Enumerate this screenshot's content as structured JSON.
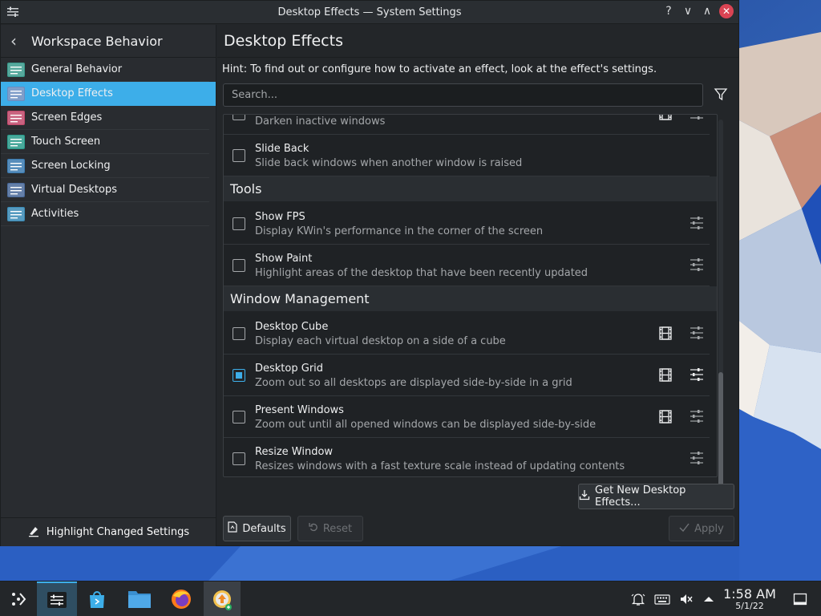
{
  "window": {
    "title": "Desktop Effects — System Settings",
    "help_glyph": "?",
    "minimize_glyph": "∨",
    "maximize_glyph": "∧",
    "close_glyph": "✕"
  },
  "sidebar": {
    "header": "Workspace Behavior",
    "back_glyph": "‹",
    "items": [
      {
        "label": "General Behavior",
        "icon_color": "#3a9a8c"
      },
      {
        "label": "Desktop Effects",
        "icon_color": "#6a8dc0"
      },
      {
        "label": "Screen Edges",
        "icon_color": "#c0486a"
      },
      {
        "label": "Touch Screen",
        "icon_color": "#2a9a8a"
      },
      {
        "label": "Screen Locking",
        "icon_color": "#3a7ab0"
      },
      {
        "label": "Virtual Desktops",
        "icon_color": "#4a6a9a"
      },
      {
        "label": "Activities",
        "icon_color": "#3a8ab5"
      }
    ],
    "footer": "Highlight Changed Settings"
  },
  "main": {
    "title": "Desktop Effects",
    "hint": "Hint: To find out or configure how to activate an effect, look at the effect's settings.",
    "search_placeholder": "Search...",
    "rows_top": [
      {
        "title": "",
        "desc": "Darken inactive windows",
        "checked": false,
        "film": true,
        "config": true
      },
      {
        "title": "Slide Back",
        "desc": "Slide back windows when another window is raised",
        "checked": false,
        "film": false,
        "config": false
      }
    ],
    "sections": [
      {
        "name": "Tools",
        "rows": [
          {
            "title": "Show FPS",
            "desc": "Display KWin's performance in the corner of the screen",
            "checked": false,
            "film": false,
            "config": true
          },
          {
            "title": "Show Paint",
            "desc": "Highlight areas of the desktop that have been recently updated",
            "checked": false,
            "film": false,
            "config": true
          }
        ]
      },
      {
        "name": "Window Management",
        "rows": [
          {
            "title": "Desktop Cube",
            "desc": "Display each virtual desktop on a side of a cube",
            "checked": false,
            "film": true,
            "config": true
          },
          {
            "title": "Desktop Grid",
            "desc": "Zoom out so all desktops are displayed side-by-side in a grid",
            "checked": true,
            "film": true,
            "config": true
          },
          {
            "title": "Present Windows",
            "desc": "Zoom out until all opened windows can be displayed side-by-side",
            "checked": false,
            "film": true,
            "config": true
          },
          {
            "title": "Resize Window",
            "desc": "Resizes windows with a fast texture scale instead of updating contents",
            "checked": false,
            "film": false,
            "config": true
          }
        ]
      }
    ],
    "get_new_label": "Get New Desktop Effects...",
    "defaults_label": "Defaults",
    "reset_label": "Reset",
    "apply_label": "Apply"
  },
  "taskbar": {
    "time": "1:58 AM",
    "date": "5/1/22",
    "accent": "#3daee9"
  }
}
